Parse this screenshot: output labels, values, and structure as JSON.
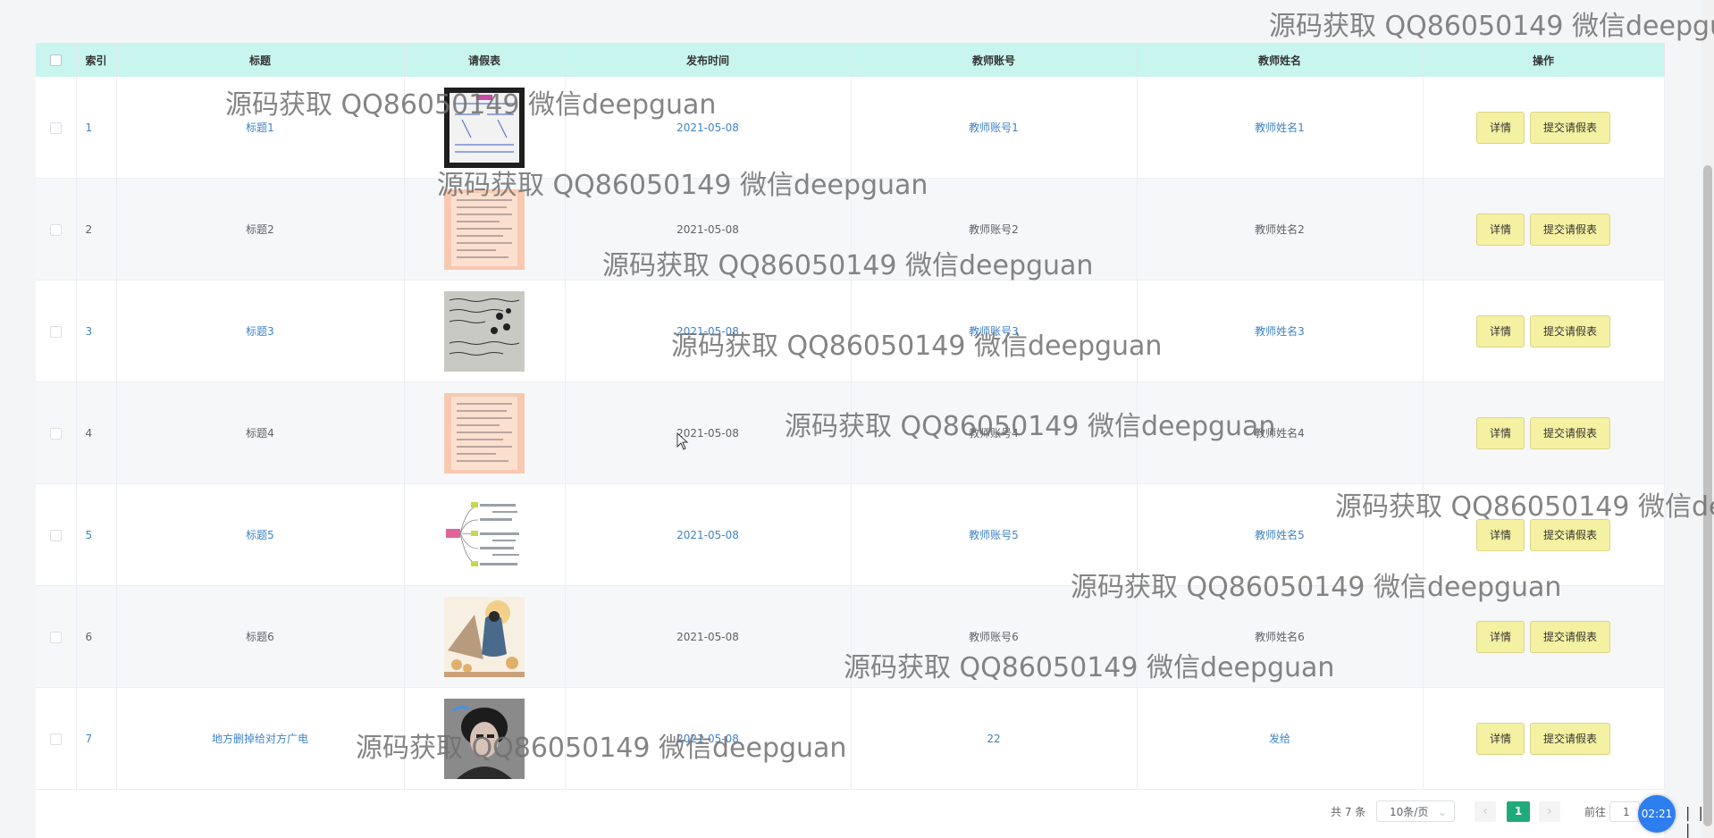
{
  "table": {
    "headers": {
      "index": "索引",
      "title": "标题",
      "leave_form": "请假表",
      "publish_time": "发布时间",
      "teacher_account": "教师账号",
      "teacher_name": "教师姓名",
      "actions": "操作"
    },
    "rows": [
      {
        "index": "1",
        "title": "标题1",
        "date": "2021-05-08",
        "account": "教师账号1",
        "name": "教师姓名1",
        "thumb": "document-photo-dark-icon"
      },
      {
        "index": "2",
        "title": "标题2",
        "date": "2021-05-08",
        "account": "教师账号2",
        "name": "教师姓名2",
        "thumb": "document-photo-pink-icon"
      },
      {
        "index": "3",
        "title": "标题3",
        "date": "2021-05-08",
        "account": "教师账号3",
        "name": "教师姓名3",
        "thumb": "handwritten-note-photo-icon"
      },
      {
        "index": "4",
        "title": "标题4",
        "date": "2021-05-08",
        "account": "教师账号4",
        "name": "教师姓名4",
        "thumb": "document-photo-pink-icon"
      },
      {
        "index": "5",
        "title": "标题5",
        "date": "2021-05-08",
        "account": "教师账号5",
        "name": "教师姓名5",
        "thumb": "mind-map-image-icon"
      },
      {
        "index": "6",
        "title": "标题6",
        "date": "2021-05-08",
        "account": "教师账号6",
        "name": "教师姓名6",
        "thumb": "illustration-image-icon"
      },
      {
        "index": "7",
        "title": "地方删掉给对方广电",
        "date": "2021-05-08",
        "account": "22",
        "name": "发给",
        "thumb": "portrait-photo-icon"
      }
    ],
    "action_labels": {
      "detail": "详情",
      "submit": "提交请假表"
    }
  },
  "pagination": {
    "total": "共 7 条",
    "page_size": "10条/页",
    "prev": "‹",
    "current": "1",
    "next": "›",
    "goto_label": "前往",
    "goto_value": "1"
  },
  "timer": "02:21",
  "player_controls": "| | |",
  "watermark": "源码获取 QQ86050149 微信deepguan",
  "watermark_top_right": "源码获取 QQ86050149 微信deepgu",
  "watermark_right": "源码获取 QQ86050149 微信de",
  "colors": {
    "header_bg": "#c9f5ef",
    "link_blue": "#3f84c8",
    "button_yellow": "#f5f1a2",
    "pager_active": "#1faa7a",
    "timer_blue": "#2e7ef0"
  }
}
